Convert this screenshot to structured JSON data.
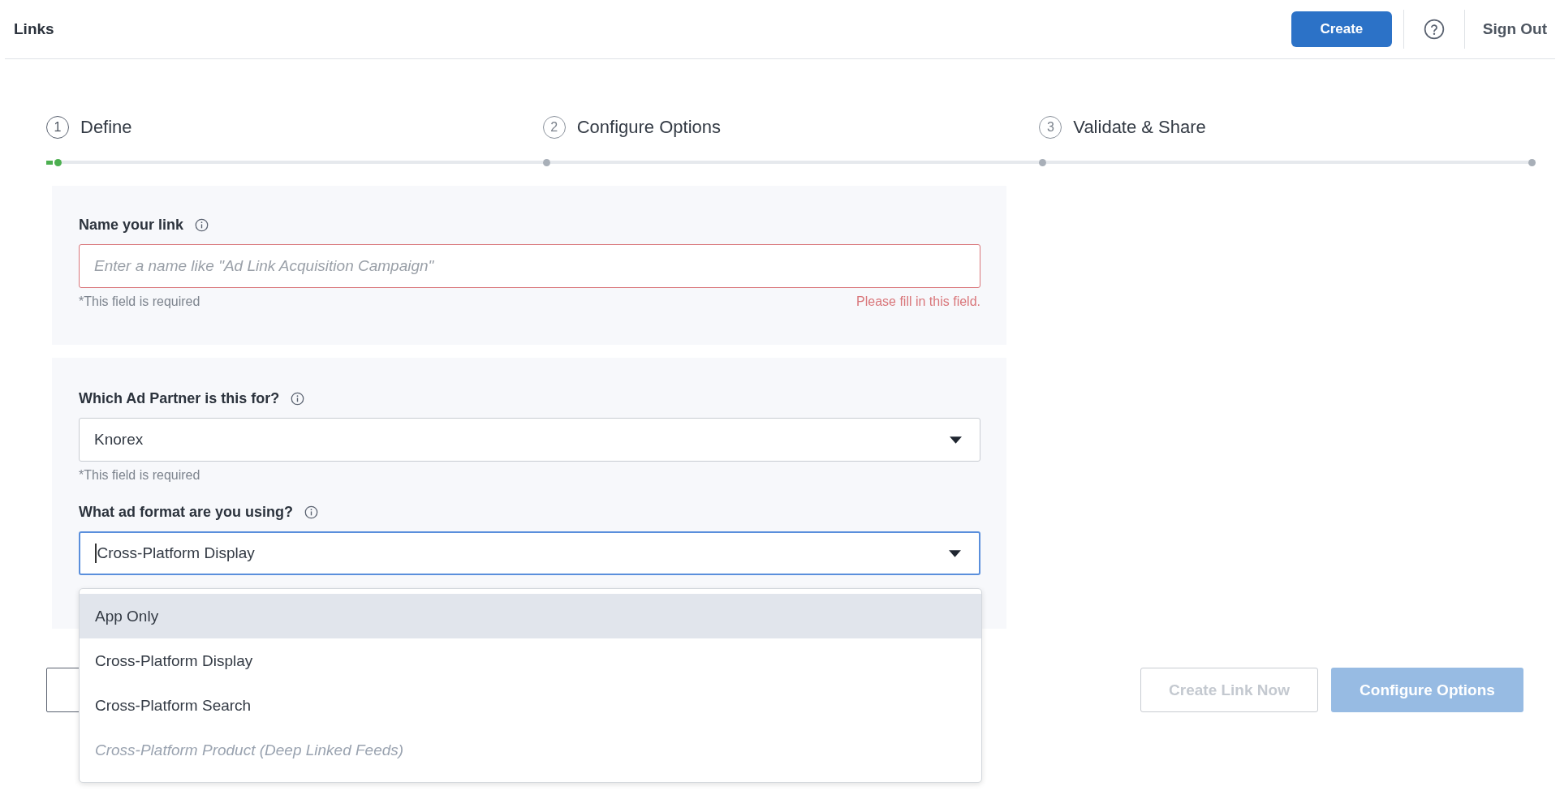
{
  "header": {
    "title": "Links",
    "create_button": "Create",
    "sign_out": "Sign Out"
  },
  "steps": [
    {
      "number": "1",
      "label": "Define",
      "active": true
    },
    {
      "number": "2",
      "label": "Configure Options",
      "active": false
    },
    {
      "number": "3",
      "label": "Validate & Share",
      "active": false
    }
  ],
  "name_section": {
    "label": "Name your link",
    "placeholder": "Enter a name like \"Ad Link Acquisition Campaign\"",
    "helper": "*This field is required",
    "error": "Please fill in this field."
  },
  "partner_section": {
    "partner_label": "Which Ad Partner is this for?",
    "partner_value": "Knorex",
    "partner_helper": "*This field is required",
    "format_label": "What ad format are you using?",
    "format_value": "Cross-Platform Display",
    "format_focused": true
  },
  "format_dropdown": {
    "expanded": true,
    "options": [
      {
        "label": "App Only",
        "selected": true,
        "disabled": false
      },
      {
        "label": "Cross-Platform Display",
        "selected": false,
        "disabled": false
      },
      {
        "label": "Cross-Platform Search",
        "selected": false,
        "disabled": false
      },
      {
        "label": "Cross-Platform Product (Deep Linked Feeds)",
        "selected": false,
        "disabled": true
      }
    ]
  },
  "footer": {
    "create_link_now": {
      "label": "Create Link Now",
      "disabled": true
    },
    "configure_options": {
      "label": "Configure Options",
      "disabled": true
    }
  }
}
